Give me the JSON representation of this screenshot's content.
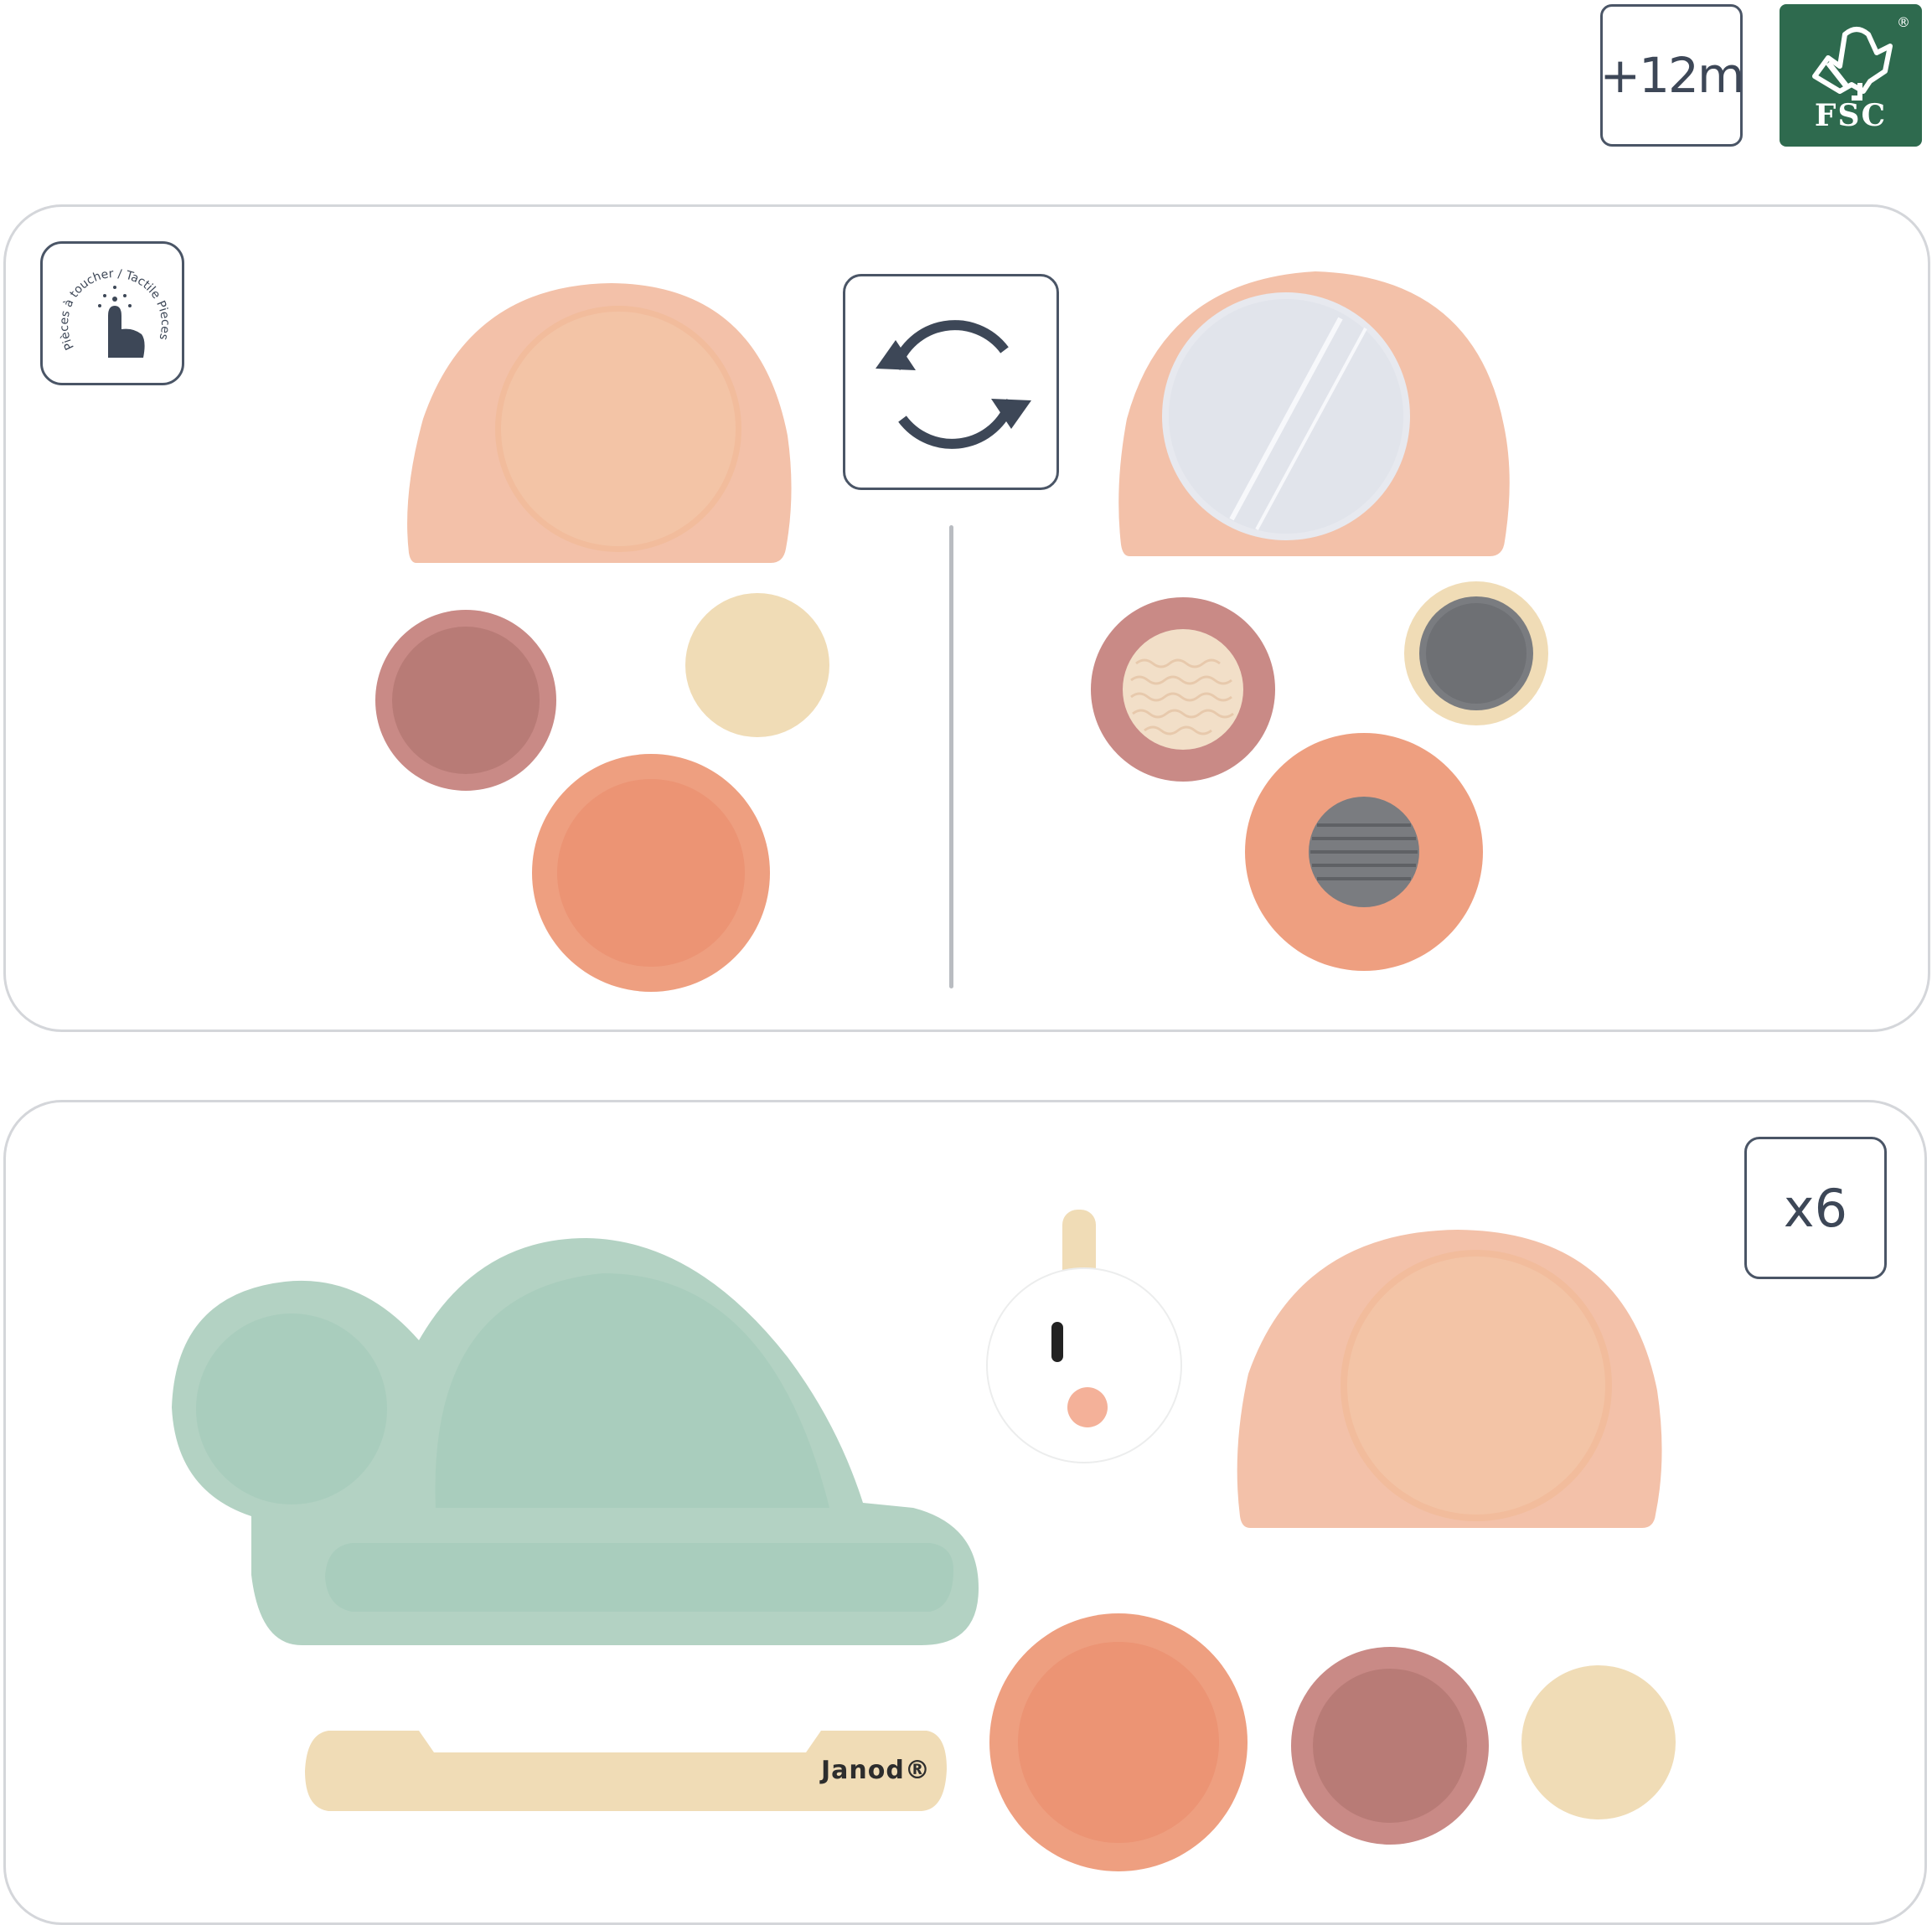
{
  "badges": {
    "age": "+12m",
    "certification": "FSC",
    "certification_mark": "®",
    "quantity": "x6"
  },
  "tactile_icon": {
    "text": "Pièces à toucher / Tactile Pieces"
  },
  "brand": {
    "name": "Janod®"
  },
  "colors": {
    "peach": "#f3c1a9",
    "peach_inner": "#f1bfa0",
    "coral": "#ee9f80",
    "coral_inner": "#ec9a7b",
    "rose": "#c98a86",
    "rose_inner": "#b87a76",
    "wood": "#f0dcb6",
    "mint": "#b3d2c3",
    "mint_inner": "#a9cdbd",
    "icon_dark": "#3d4757",
    "fsc_green": "#2e6a4e",
    "panel_border": "#d4d6da"
  }
}
